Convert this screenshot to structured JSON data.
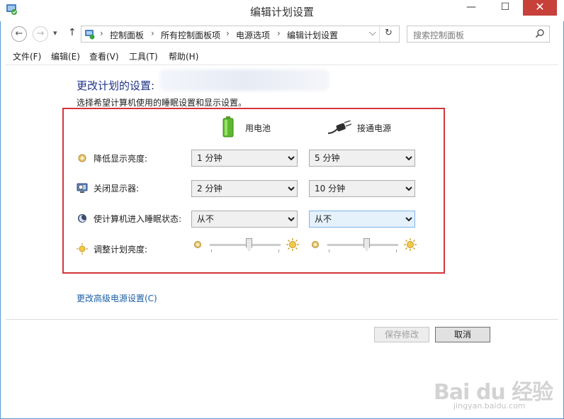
{
  "window": {
    "title": "编辑计划设置",
    "minimize": "—",
    "maximize": "☐",
    "close": "✕"
  },
  "nav": {
    "back": "←",
    "forward": "→",
    "dropdown": "▾",
    "up": "↑",
    "refresh": "↻",
    "address_dropdown": "⌵"
  },
  "breadcrumb": [
    "控制面板",
    "所有控制面板项",
    "电源选项",
    "编辑计划设置"
  ],
  "breadcrumb_sep": "›",
  "search": {
    "placeholder": "搜索控制面板"
  },
  "menu": [
    "文件(F)",
    "编辑(E)",
    "查看(V)",
    "工具(T)",
    "帮助(H)"
  ],
  "content": {
    "heading": "更改计划的设置:",
    "description": "选择希望计算机使用的睡眠设置和显示设置。",
    "columns": {
      "battery": "用电池",
      "plugged": "接通电源"
    },
    "rows": [
      {
        "label": "降低显示亮度:",
        "icon": "dim-display-icon",
        "battery": "1 分钟",
        "plugged": "5 分钟"
      },
      {
        "label": "关闭显示器:",
        "icon": "display-off-icon",
        "battery": "2 分钟",
        "plugged": "10 分钟"
      },
      {
        "label": "使计算机进入睡眠状态:",
        "icon": "sleep-icon",
        "battery": "从不",
        "plugged": "从不"
      }
    ],
    "brightness": {
      "label": "调整计划亮度:",
      "battery_level": 0.55,
      "plugged_level": 0.55
    },
    "advanced_link": "更改高级电源设置(C)"
  },
  "buttons": {
    "save": "保存修改",
    "cancel": "取消"
  },
  "watermark": {
    "main": "Bai du 经验",
    "sub": "jingyan.baidu.com"
  },
  "colors": {
    "accent": "#1e3287",
    "highlight_box": "#d5353a",
    "close": "#c7403a",
    "link": "#1a5fa5"
  }
}
